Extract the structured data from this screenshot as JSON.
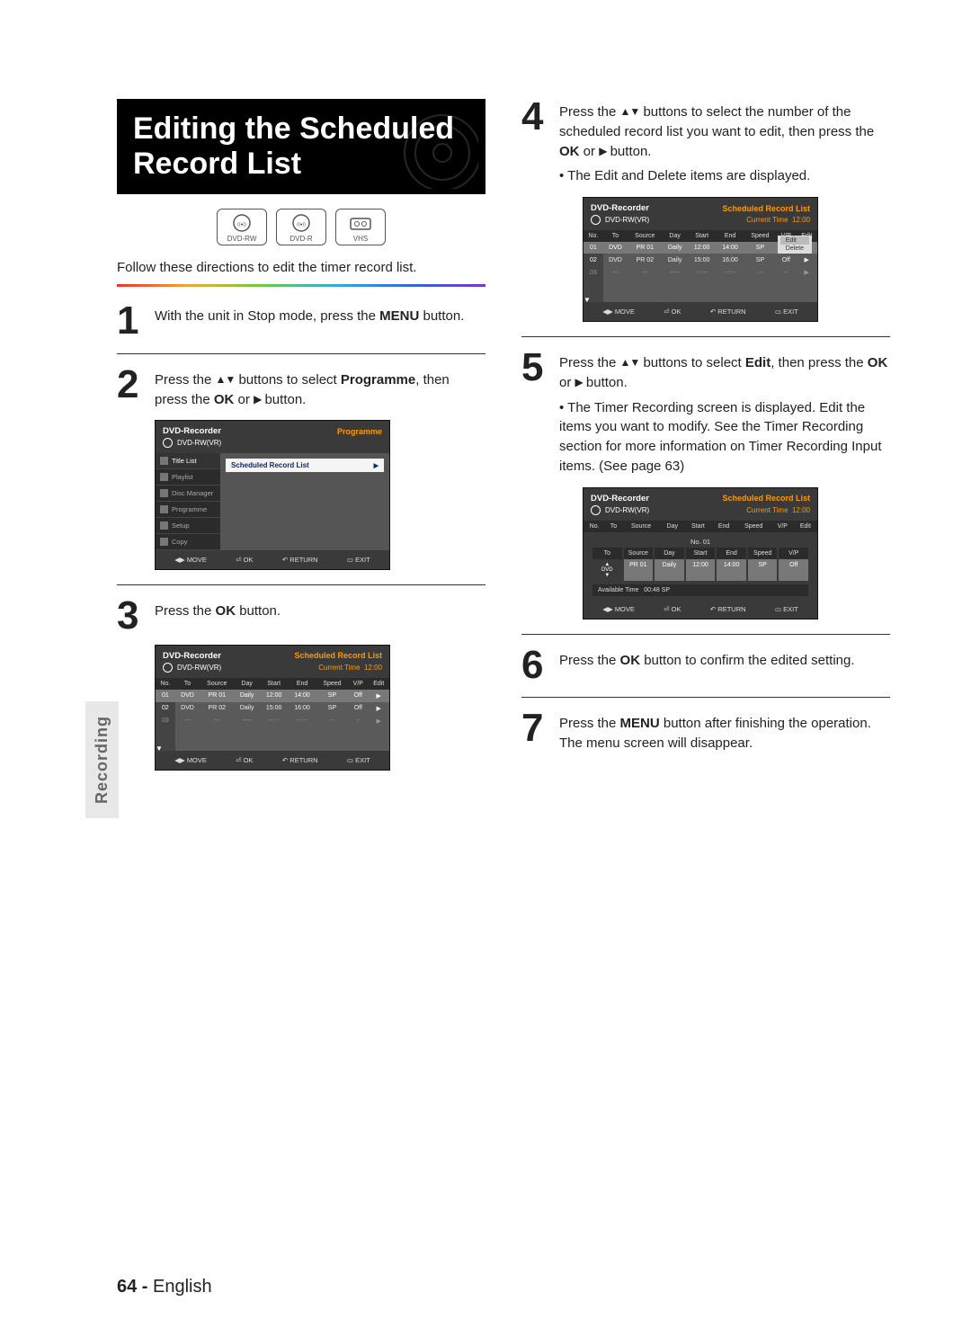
{
  "page": {
    "number": "64",
    "language": "English",
    "section_tab": "Recording"
  },
  "title": {
    "line1": "Editing the Scheduled",
    "line2": "Record List"
  },
  "badges": {
    "dvdrw": "DVD-RW",
    "dvdr": "DVD-R",
    "vhs": "VHS"
  },
  "intro": "Follow these directions to edit the timer record list.",
  "steps": {
    "s1": {
      "num": "1",
      "t1": "With the unit in Stop mode, press the ",
      "b1": "MENU",
      "t2": " button."
    },
    "s2": {
      "num": "2",
      "t1": "Press the ",
      "t2": " buttons to select ",
      "b1": "Programme",
      "t3": ", then press the ",
      "b2": "OK",
      "t4": " or ",
      "t5": " button."
    },
    "s3": {
      "num": "3",
      "t1": "Press the ",
      "b1": "OK",
      "t2": " button."
    },
    "s4": {
      "num": "4",
      "t1": "Press the ",
      "t2": " buttons to select the number of the scheduled record list you want to edit, then press the ",
      "b1": "OK",
      "t3": " or ",
      "t4": " button.",
      "bullet": "The Edit and Delete items are displayed."
    },
    "s5": {
      "num": "5",
      "t1": "Press the ",
      "t2": " buttons to select ",
      "b1": "Edit",
      "t3": ", then press the ",
      "b2": "OK",
      "t4": " or ",
      "t5": " button.",
      "bullet": "The Timer Recording screen is displayed. Edit the items you want to modify. See the Timer Recording section for more information on Timer Recording Input items. (See page 63)"
    },
    "s6": {
      "num": "6",
      "t1": "Press the ",
      "b1": "OK",
      "t2": " button to confirm the edited setting."
    },
    "s7": {
      "num": "7",
      "t1": "Press the ",
      "b1": "MENU",
      "t2": " button after finishing the operation. The menu screen will disappear."
    }
  },
  "osd": {
    "device": "DVD-Recorder",
    "disc": "DVD-RW(VR)",
    "prog_label": "Programme",
    "srl_label": "Scheduled Record List",
    "current_time_label": "Current Time",
    "current_time": "12:00",
    "menu": {
      "title_list": "Title List",
      "playlist": "Playlist",
      "disc_manager": "Disc Manager",
      "programme": "Programme",
      "setup": "Setup",
      "copy": "Copy"
    },
    "cols": {
      "no": "No.",
      "to": "To",
      "source": "Source",
      "day": "Day",
      "start": "Start",
      "end": "End",
      "speed": "Speed",
      "vp": "V/P",
      "edit": "Edit"
    },
    "rows": [
      {
        "no": "01",
        "to": "DVD",
        "source": "PR 01",
        "day": "Daily",
        "start": "12:00",
        "end": "14:00",
        "speed": "SP",
        "vp": "Off",
        "edit": "▶"
      },
      {
        "no": "02",
        "to": "DVD",
        "source": "PR 02",
        "day": "Daily",
        "start": "15:00",
        "end": "16:00",
        "speed": "SP",
        "vp": "Off",
        "edit": "▶"
      },
      {
        "no": "03",
        "to": "---",
        "source": "---",
        "day": "-----",
        "start": "--:--",
        "end": "--:--",
        "speed": "--",
        "vp": "--",
        "edit": "▶"
      }
    ],
    "popup": {
      "edit": "Edit",
      "delete": "Delete"
    },
    "edit_detail": {
      "no_label": "No. 01",
      "cols": [
        "To",
        "Source",
        "Day",
        "Start",
        "End",
        "Speed",
        "V/P"
      ],
      "vals": [
        "DVD",
        "PR 01",
        "Daily",
        "12:00",
        "14:00",
        "SP",
        "Off"
      ],
      "available_label": "Available Time",
      "available_value": "00:48  SP"
    },
    "footer": {
      "move": "MOVE",
      "ok": "OK",
      "return": "RETURN",
      "exit": "EXIT"
    }
  }
}
